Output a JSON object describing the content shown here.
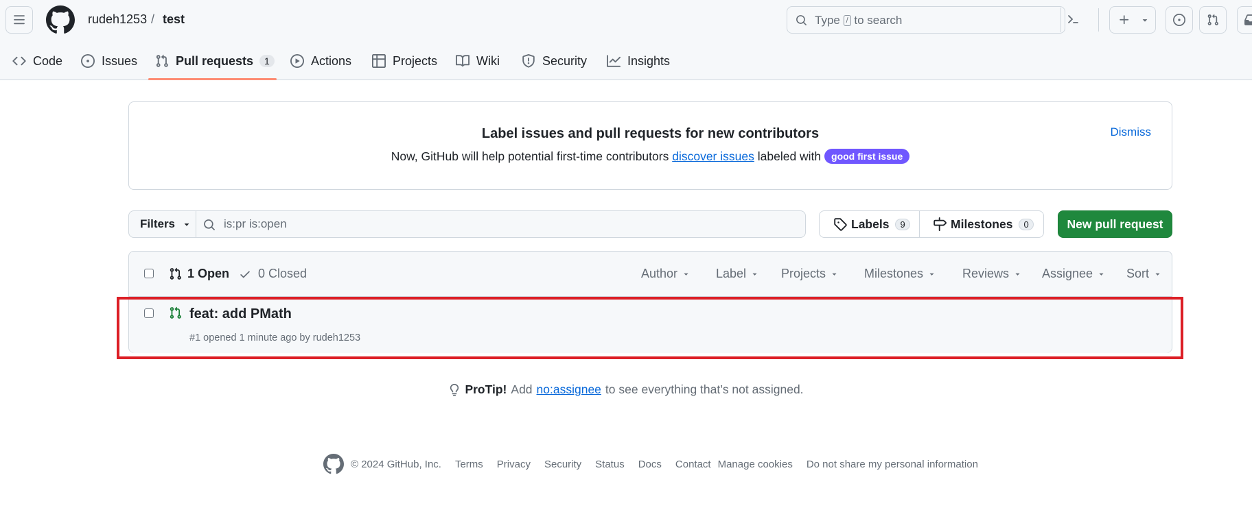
{
  "header": {
    "owner": "rudeh1253",
    "separator": "/",
    "repo": "test",
    "search_prefix": "Type",
    "search_key": "/",
    "search_suffix": "to search",
    "icons": [
      "hamburger-icon",
      "github-logo",
      "search-icon",
      "command-palette-icon",
      "plus-icon",
      "issue-icon",
      "pull-request-icon",
      "inbox-icon"
    ]
  },
  "tabs": [
    {
      "label": "Code",
      "icon": "code-icon"
    },
    {
      "label": "Issues",
      "icon": "issue-opened-icon"
    },
    {
      "label": "Pull requests",
      "icon": "git-pull-request-icon",
      "count": "1",
      "selected": true
    },
    {
      "label": "Actions",
      "icon": "play-icon"
    },
    {
      "label": "Projects",
      "icon": "table-icon"
    },
    {
      "label": "Wiki",
      "icon": "book-icon"
    },
    {
      "label": "Security",
      "icon": "shield-icon"
    },
    {
      "label": "Insights",
      "icon": "graph-icon"
    }
  ],
  "banner": {
    "title": "Label issues and pull requests for new contributors",
    "text_before": "Now, GitHub will help potential first-time contributors",
    "link": "discover issues",
    "text_after": "labeled with",
    "badge": "good first issue",
    "badge_color": "#7057ff",
    "dismiss": "Dismiss"
  },
  "toolbar": {
    "filters_label": "Filters",
    "filter_query": "is:pr is:open",
    "labels_label": "Labels",
    "labels_count": "9",
    "milestones_label": "Milestones",
    "milestones_count": "0",
    "new_pr_label": "New pull request",
    "new_pr_color": "#1f883d"
  },
  "list": {
    "open_label": "1 Open",
    "closed_label": "0 Closed",
    "filters": [
      "Author",
      "Label",
      "Projects",
      "Milestones",
      "Reviews",
      "Assignee",
      "Sort"
    ],
    "items": [
      {
        "title": "feat: add PMath",
        "meta": "#1 opened 1 minute ago by rudeh1253",
        "state_color": "#1a7f37"
      }
    ]
  },
  "protip": {
    "label": "ProTip!",
    "before": "Add",
    "link": "no:assignee",
    "after": "to see everything that’s not assigned."
  },
  "footer": {
    "copyright": "© 2024 GitHub, Inc.",
    "links": [
      "Terms",
      "Privacy",
      "Security",
      "Status",
      "Docs",
      "Contact",
      "Manage cookies",
      "Do not share my personal information"
    ]
  },
  "highlight_color": "#dc1f26"
}
